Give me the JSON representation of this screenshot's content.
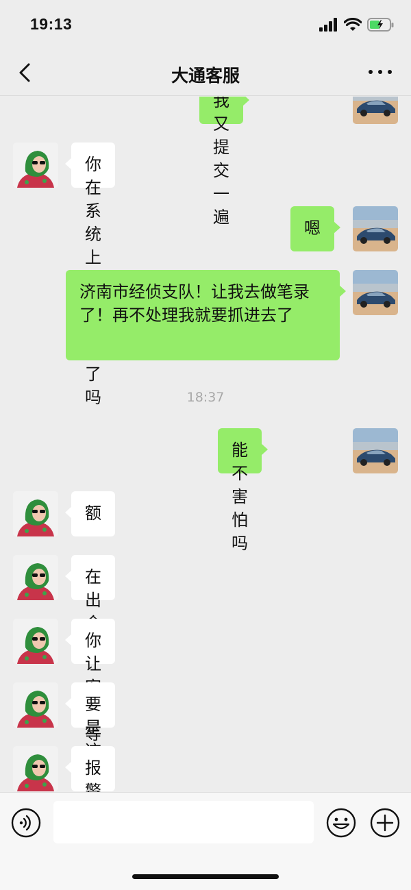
{
  "status_bar": {
    "time": "19:13"
  },
  "nav": {
    "title": "大通客服"
  },
  "messages": [
    {
      "side": "right",
      "text": "我又提交一遍"
    },
    {
      "side": "left",
      "text": "你在系统上申请出金了吗"
    },
    {
      "side": "right",
      "text": "嗯"
    },
    {
      "side": "right",
      "text": "济南市经侦支队！让我去做笔录了！再不处理我就要抓进去了"
    },
    {
      "side": "right",
      "text": "能不害怕吗"
    },
    {
      "side": "left",
      "text": "额"
    },
    {
      "side": "left",
      "text": "在出金牙"
    },
    {
      "side": "left",
      "text": "你让客户等等"
    },
    {
      "side": "left",
      "text": "要是这个星期没有动静 再说"
    },
    {
      "side": "left",
      "text": "报警有什么用 大通是有监管的"
    }
  ],
  "timestamp": "18:37",
  "colors": {
    "self_bubble": "#95ec69",
    "other_bubble": "#ffffff",
    "background": "#ededed"
  },
  "icons": {
    "back": "chevron-left-icon",
    "more": "more-icon",
    "voice": "voice-icon",
    "emoji": "emoji-icon",
    "plus": "plus-icon"
  }
}
